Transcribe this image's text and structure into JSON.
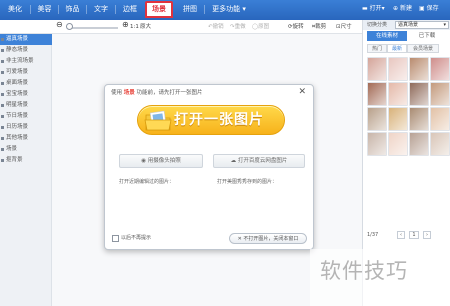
{
  "topbar": {
    "tabs": [
      {
        "label": "美化",
        "active": false
      },
      {
        "label": "美容",
        "active": false
      },
      {
        "label": "饰品",
        "active": false
      },
      {
        "label": "文字",
        "active": false
      },
      {
        "label": "边框",
        "active": false
      },
      {
        "label": "场景",
        "active": true
      },
      {
        "label": "拼图",
        "active": false
      },
      {
        "label": "更多功能",
        "active": false
      }
    ],
    "open_label": "打开",
    "new_label": "新建",
    "save_label": "保存"
  },
  "toolbar": {
    "fit_label": "1:1",
    "original_label": "原大",
    "undo_label": "撤销",
    "redo_label": "重做",
    "reset_label": "原图",
    "rotate_label": "旋转",
    "crop_label": "裁剪",
    "size_label": "尺寸"
  },
  "categories": [
    {
      "label": "逼真场景",
      "selected": true
    },
    {
      "label": "静态场景",
      "selected": false
    },
    {
      "label": "非主流场景",
      "selected": false
    },
    {
      "label": "可爱场景",
      "selected": false
    },
    {
      "label": "桌面场景",
      "selected": false
    },
    {
      "label": "宝宝场景",
      "selected": false
    },
    {
      "label": "明星场景",
      "selected": false
    },
    {
      "label": "节日场景",
      "selected": false
    },
    {
      "label": "日历场景",
      "selected": false
    },
    {
      "label": "其他场景",
      "selected": false
    },
    {
      "label": "场景",
      "selected": false
    },
    {
      "label": "抠背景",
      "selected": false
    }
  ],
  "right_panel": {
    "category_label": "切换分类",
    "category_value": "逼真场景",
    "tabs": [
      "在线素材",
      "已下载"
    ],
    "subtabs": [
      "热门",
      "最新",
      "会员场景"
    ],
    "thumb_colors": [
      "#d4a59a",
      "#e8c7c0",
      "#b98c6f",
      "#cf8e8b",
      "#a36a55",
      "#e4b9a9",
      "#8f6a5a",
      "#c39a7d",
      "#b8a08a",
      "#d8b27a",
      "#a98b72",
      "#e2c1a6",
      "#c8b5a9",
      "#efd4c7",
      "#b7a194",
      "#d9c6b8"
    ],
    "page_current": "1",
    "page_total": "1/37"
  },
  "dialog": {
    "title_prefix": "使用",
    "title_highlight": "场景",
    "title_suffix": "功能前，请先打开一张图片",
    "open_button_label": "打开一张图片",
    "camera_label": "用摄像头拍照",
    "cloud_label": "打开百度云网盘图片",
    "recent_label": "打开近期编辑过的图片：",
    "recent_other_label": "打开美图秀秀存到的图片：",
    "checkbox_label": "以后不再提示",
    "skip_button_label": "不打开图片，关闭本窗口"
  },
  "watermark": "软件技巧"
}
